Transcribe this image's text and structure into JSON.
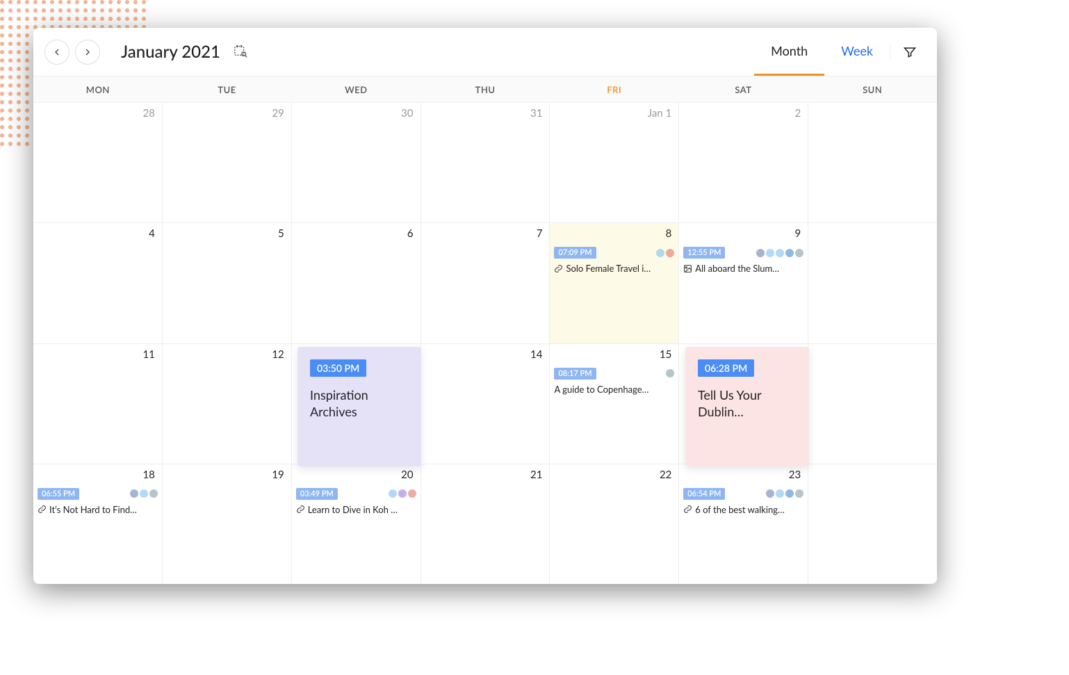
{
  "header": {
    "title": "January 2021",
    "prev_aria": "Previous",
    "next_aria": "Next",
    "tabs": {
      "month": "Month",
      "week": "Week",
      "active": "month"
    }
  },
  "day_labels": [
    "MON",
    "TUE",
    "WED",
    "THU",
    "FRI",
    "SAT",
    "SUN"
  ],
  "today_column_index": 4,
  "weeks": [
    [
      {
        "label": "28",
        "in": false
      },
      {
        "label": "29",
        "in": false
      },
      {
        "label": "30",
        "in": false
      },
      {
        "label": "31",
        "in": false
      },
      {
        "label": "Jan 1",
        "in": false
      },
      {
        "label": "2",
        "in": false
      },
      {
        "label": "",
        "in": false
      }
    ],
    [
      {
        "label": "4",
        "in": true
      },
      {
        "label": "5",
        "in": true
      },
      {
        "label": "6",
        "in": true
      },
      {
        "label": "7",
        "in": true
      },
      {
        "label": "8",
        "in": true,
        "hl": "yellow",
        "event": {
          "time": "07:09 PM",
          "title": "Solo Female Travel i…",
          "type": "link",
          "icons": [
            "tw",
            "gp"
          ]
        }
      },
      {
        "label": "9",
        "in": true,
        "event": {
          "time": "12:55 PM",
          "title": "All aboard the Slum…",
          "type": "image",
          "icons": [
            "fb",
            "tw",
            "tw",
            "li",
            "bl"
          ]
        }
      },
      {
        "label": "",
        "in": false
      }
    ],
    [
      {
        "label": "11",
        "in": true
      },
      {
        "label": "12",
        "in": true
      },
      {
        "label": "",
        "in": true
      },
      {
        "label": "14",
        "in": true
      },
      {
        "label": "15",
        "in": true,
        "event": {
          "time": "08:17 PM",
          "title": "A guide to Copenhage…",
          "type": "none",
          "icons": [
            "bl"
          ]
        }
      },
      {
        "label": "",
        "in": true
      },
      {
        "label": "",
        "in": false
      }
    ],
    [
      {
        "label": "18",
        "in": true,
        "event": {
          "time": "06:55 PM",
          "title": "It's Not Hard to Find…",
          "type": "link",
          "icons": [
            "fb",
            "tw",
            "bl"
          ]
        }
      },
      {
        "label": "19",
        "in": true
      },
      {
        "label": "20",
        "in": true,
        "event": {
          "time": "03:49 PM",
          "title": "Learn to Dive in Koh …",
          "type": "link",
          "icons": [
            "tw",
            "ig",
            "gp"
          ]
        }
      },
      {
        "label": "21",
        "in": true
      },
      {
        "label": "22",
        "in": true
      },
      {
        "label": "23",
        "in": true,
        "event": {
          "time": "06:54 PM",
          "title": "6 of the best walking…",
          "type": "link",
          "icons": [
            "fb",
            "tw",
            "li",
            "bl"
          ]
        }
      },
      {
        "label": "",
        "in": false
      }
    ]
  ],
  "overlays": {
    "purple": {
      "time": "03:50 PM",
      "title": "Inspiration Archives"
    },
    "pink": {
      "time": "06:28 PM",
      "title": "Tell Us Your Dublin…"
    }
  }
}
